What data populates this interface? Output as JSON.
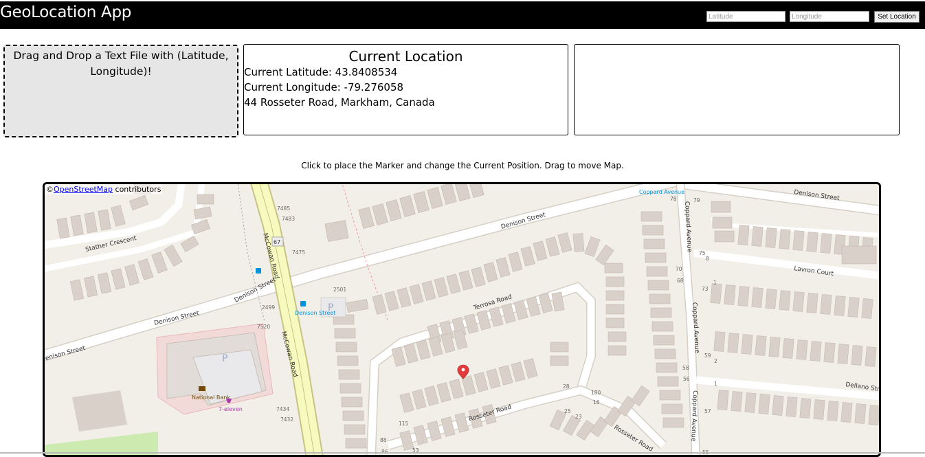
{
  "header": {
    "app_title": "GeoLocation App",
    "latitude_placeholder": "Latitude",
    "longitude_placeholder": "Longitude",
    "set_location_label": "Set Location"
  },
  "drop_zone": {
    "text": "Drag and Drop a Text File with (Latitude, Longitude)!"
  },
  "current_location": {
    "title": "Current Location",
    "latitude_line": "Current Latitude: 43.8408534",
    "longitude_line": "Current Longitude: -79.276058",
    "address": "44 Rosseter Road, Markham, Canada"
  },
  "instructions": "Click to place the Marker and change the Current Position. Drag to move Map.",
  "map": {
    "attribution_symbol": "©",
    "attribution_link": "OpenStreetMap",
    "attribution_suffix": " contributors",
    "colors": {
      "background": "#f2efe9",
      "building": "#d9d0c9",
      "road": "#ffffff",
      "primary_road": "#f7fabf",
      "commercial": "#f2dad9",
      "park": "#cdebb0",
      "marker": "#e23b3b"
    },
    "labels": {
      "denison_street": "Denison Street",
      "mccowan_road": "McCowan Road",
      "stather_crescent": "Stather Crescent",
      "terrosa_road": "Terrosa Road",
      "rosseter_road": "Rosseter Road",
      "coppard_avenue": "Coppard Avenue",
      "lavron_court": "Lavron Court",
      "dellano_street": "Dellano Street",
      "national_bank": "National Bank",
      "seven_eleven": "7-eleven",
      "bus_stop": "Denison Street",
      "route_shield": "67",
      "house_7485": "7485",
      "house_7483": "7483",
      "house_7475": "7475",
      "house_2501": "2501",
      "house_2499": "2499",
      "house_7520": "7520",
      "house_7434": "7434",
      "house_7432": "7432",
      "house_28": "28",
      "house_25": "25",
      "house_23": "23",
      "house_180": "180",
      "house_16": "16",
      "house_115": "115",
      "house_88": "88",
      "house_86": "86",
      "house_53": "53",
      "house_78": "78",
      "house_79": "79",
      "house_75": "75",
      "house_70": "70",
      "house_68": "68",
      "house_73": "73",
      "house_59": "59",
      "house_58": "58",
      "house_56": "56",
      "house_57": "57",
      "house_55": "55",
      "house_1": "1",
      "house_2": "2",
      "house_8": "8",
      "parking": "P"
    }
  }
}
